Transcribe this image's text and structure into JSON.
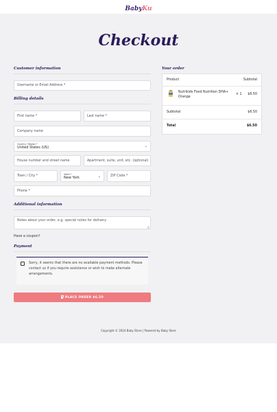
{
  "brand": {
    "part1": "Baby",
    "part2": "Ku"
  },
  "page_title": "Checkout",
  "customer": {
    "heading": "Customer information",
    "username_placeholder": "Username or Email Address *"
  },
  "billing": {
    "heading": "Billing details",
    "first_name": "First name *",
    "last_name": "Last name *",
    "company": "Company name",
    "country_label": "Country / Region *",
    "country_value": "United States (US)",
    "address1": "House number and street name",
    "address2": "Apartment, suite, unit, etc. (optional)",
    "city": "Town / City *",
    "state_label": "State *",
    "state_value": "New York",
    "zip": "ZIP Code *",
    "phone": "Phone *"
  },
  "additional": {
    "heading": "Additional information",
    "notes_placeholder": "Notes about your order, e.g. special notes for delivery."
  },
  "coupon_link": "Have a coupon?",
  "payment": {
    "heading": "Payment",
    "notice": "Sorry, it seems that there are no available payment methods. Please contact us if you require assistance or wish to make alternate arrangements."
  },
  "place_order": "PLACE ORDER $6.50",
  "order": {
    "heading": "Your order",
    "col_product": "Product",
    "col_subtotal": "Subtotal",
    "item_name_line1": "Nutrikids Food Nutrition DHA+",
    "item_name_line2": "Orange",
    "item_qty": "× 1",
    "item_price": "$6.50",
    "subtotal_label": "Subtotal",
    "subtotal_value": "$6.50",
    "total_label": "Total",
    "total_value": "$6.50"
  },
  "footer": "Copyright © 2024 Baby Store | Powered by Baby Store"
}
